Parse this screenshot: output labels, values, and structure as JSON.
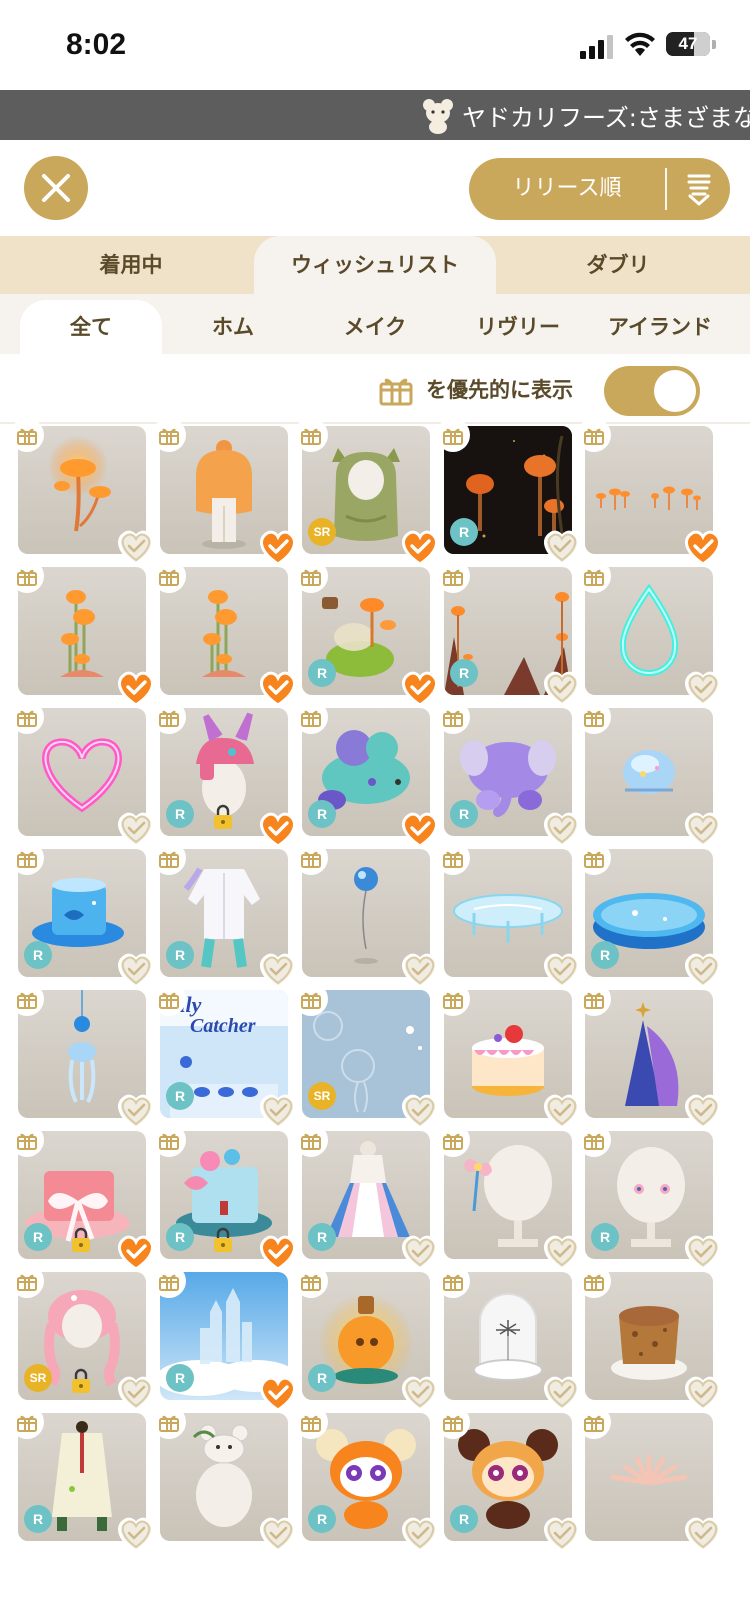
{
  "status": {
    "time": "8:02",
    "battery": "47"
  },
  "ticker": {
    "text": "ヤドカリフーズ:さまざまな"
  },
  "header": {
    "sort_label": "リリース順"
  },
  "tabs": [
    {
      "label": "着用中",
      "active": false
    },
    {
      "label": "ウィッシュリスト",
      "active": true
    },
    {
      "label": "ダブリ",
      "active": false
    }
  ],
  "subtabs": [
    {
      "label": "全て",
      "active": true
    },
    {
      "label": "ホム",
      "active": false
    },
    {
      "label": "メイク",
      "active": false
    },
    {
      "label": "リヴリー",
      "active": false
    },
    {
      "label": "アイランド",
      "active": false
    }
  ],
  "priority": {
    "label": "を優先的に表示",
    "toggle_on": true
  },
  "colors": {
    "gold": "#c9a85b",
    "orange": "#f7841c",
    "rarity_r": "#6cc2c5",
    "rarity_sr": "#e8b327"
  },
  "items": [
    {
      "name": "orange-mushroom-light",
      "art": "mush1",
      "rarity": "",
      "locked": false,
      "wished": false
    },
    {
      "name": "orange-bob-hair",
      "art": "hair-orange",
      "rarity": "",
      "locked": false,
      "wished": true
    },
    {
      "name": "green-wavy-hair",
      "art": "hair-green",
      "rarity": "SR",
      "locked": false,
      "wished": true
    },
    {
      "name": "night-mushroom-background",
      "art": "mush-night",
      "rarity": "R",
      "locked": false,
      "wished": false
    },
    {
      "name": "mini-mushroom-row",
      "art": "mush-row",
      "rarity": "",
      "locked": false,
      "wished": true
    },
    {
      "name": "mushroom-cluster-a",
      "art": "mush-cluster",
      "rarity": "",
      "locked": false,
      "wished": true
    },
    {
      "name": "mushroom-cluster-b",
      "art": "mush-cluster",
      "rarity": "",
      "locked": false,
      "wished": true
    },
    {
      "name": "mushroom-bottle-garden",
      "art": "mush-bottle",
      "rarity": "R",
      "locked": false,
      "wished": true
    },
    {
      "name": "mushroom-frame",
      "art": "mush-frame",
      "rarity": "R",
      "locked": false,
      "wished": false
    },
    {
      "name": "neon-drop",
      "art": "neon-drop",
      "rarity": "",
      "locked": false,
      "wished": false
    },
    {
      "name": "neon-heart",
      "art": "neon-heart",
      "rarity": "",
      "locked": false,
      "wished": false
    },
    {
      "name": "bunny-hood-hat",
      "art": "bunny-hat",
      "rarity": "R",
      "locked": true,
      "wished": true
    },
    {
      "name": "plush-turtle",
      "art": "plush-turtle",
      "rarity": "R",
      "locked": false,
      "wished": true
    },
    {
      "name": "plush-elephant",
      "art": "plush-elephant",
      "rarity": "R",
      "locked": false,
      "wished": false
    },
    {
      "name": "jelly-slime",
      "art": "jelly",
      "rarity": "",
      "locked": false,
      "wished": false
    },
    {
      "name": "aquarium-hat",
      "art": "aqua-hat",
      "rarity": "R",
      "locked": false,
      "wished": false
    },
    {
      "name": "white-jacket-outfit",
      "art": "jacket",
      "rarity": "R",
      "locked": false,
      "wished": false
    },
    {
      "name": "blue-balloon",
      "art": "balloon",
      "rarity": "",
      "locked": false,
      "wished": false
    },
    {
      "name": "glass-table",
      "art": "glass-table",
      "rarity": "",
      "locked": false,
      "wished": false
    },
    {
      "name": "water-pool",
      "art": "pool",
      "rarity": "R",
      "locked": false,
      "wished": false
    },
    {
      "name": "jellyfish-hanging",
      "art": "jelly-hang",
      "rarity": "",
      "locked": false,
      "wished": false
    },
    {
      "name": "lily-catcher-machine",
      "art": "catcher",
      "rarity": "R",
      "locked": false,
      "wished": false
    },
    {
      "name": "underwater-jellyfish-bg",
      "art": "underwater",
      "rarity": "SR",
      "locked": false,
      "wished": false
    },
    {
      "name": "strawberry-cake",
      "art": "cake",
      "rarity": "",
      "locked": false,
      "wished": false
    },
    {
      "name": "star-cone-tree",
      "art": "cone",
      "rarity": "",
      "locked": false,
      "wished": false
    },
    {
      "name": "pink-ribbon-hat",
      "art": "pink-hat",
      "rarity": "R",
      "locked": true,
      "wished": true
    },
    {
      "name": "rose-top-hat",
      "art": "rose-hat",
      "rarity": "R",
      "locked": true,
      "wished": true
    },
    {
      "name": "lolita-dress",
      "art": "dress",
      "rarity": "R",
      "locked": false,
      "wished": false
    },
    {
      "name": "ribbon-hair-accessory",
      "art": "head-ribbon",
      "rarity": "",
      "locked": false,
      "wished": false
    },
    {
      "name": "pink-eyes-makeup",
      "art": "head-eyes",
      "rarity": "R",
      "locked": false,
      "wished": false
    },
    {
      "name": "pink-braid-hair",
      "art": "braid",
      "rarity": "SR",
      "locked": true,
      "wished": false
    },
    {
      "name": "sky-castle-bg",
      "art": "castle",
      "rarity": "R",
      "locked": false,
      "wished": true
    },
    {
      "name": "lion-lantern-bottle",
      "art": "lantern",
      "rarity": "R",
      "locked": false,
      "wished": false
    },
    {
      "name": "glass-dome",
      "art": "dome",
      "rarity": "",
      "locked": false,
      "wished": false
    },
    {
      "name": "cork-stool",
      "art": "cork",
      "rarity": "",
      "locked": false,
      "wished": false
    },
    {
      "name": "white-lab-coat",
      "art": "coat",
      "rarity": "R",
      "locked": false,
      "wished": false
    },
    {
      "name": "bear-on-head",
      "art": "bear-head",
      "rarity": "",
      "locked": false,
      "wished": false
    },
    {
      "name": "orange-bear-plush",
      "art": "bear-orange",
      "rarity": "R",
      "locked": false,
      "wished": false
    },
    {
      "name": "brown-bear-plush",
      "art": "bear-brown",
      "rarity": "R",
      "locked": false,
      "wished": false
    },
    {
      "name": "pink-coral",
      "art": "coral",
      "rarity": "",
      "locked": false,
      "wished": false
    }
  ]
}
